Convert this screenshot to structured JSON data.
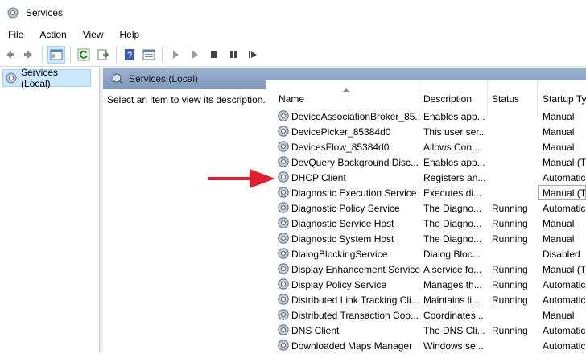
{
  "window": {
    "title": "Services"
  },
  "menu": [
    "File",
    "Action",
    "View",
    "Help"
  ],
  "tree": {
    "selected_label": "Services (Local)"
  },
  "pane": {
    "header_title": "Services (Local)",
    "description_text": "Select an item to view its description."
  },
  "table": {
    "columns": [
      "Name",
      "Description",
      "Status",
      "Startup Ty"
    ],
    "rows": [
      {
        "name": "DeviceAssociationBroker_85...",
        "description": "Enables app...",
        "status": "",
        "startup": "Manual"
      },
      {
        "name": "DevicePicker_85384d0",
        "description": "This user ser...",
        "status": "",
        "startup": "Manual"
      },
      {
        "name": "DevicesFlow_85384d0",
        "description": "Allows Con...",
        "status": "",
        "startup": "Manual"
      },
      {
        "name": "DevQuery Background Disc...",
        "description": "Enables app...",
        "status": "",
        "startup": "Manual (T"
      },
      {
        "name": "DHCP Client",
        "description": "Registers an...",
        "status": "",
        "startup": "Automatic"
      },
      {
        "name": "Diagnostic Execution Service",
        "description": "Executes di...",
        "status": "",
        "startup": "Manual (T"
      },
      {
        "name": "Diagnostic Policy Service",
        "description": "The Diagno...",
        "status": "Running",
        "startup": "Automatic"
      },
      {
        "name": "Diagnostic Service Host",
        "description": "The Diagno...",
        "status": "Running",
        "startup": "Manual"
      },
      {
        "name": "Diagnostic System Host",
        "description": "The Diagno...",
        "status": "Running",
        "startup": "Manual"
      },
      {
        "name": "DialogBlockingService",
        "description": "Dialog Bloc...",
        "status": "",
        "startup": "Disabled"
      },
      {
        "name": "Display Enhancement Service",
        "description": "A service fo...",
        "status": "Running",
        "startup": "Manual (T"
      },
      {
        "name": "Display Policy Service",
        "description": "Manages th...",
        "status": "Running",
        "startup": "Automatic"
      },
      {
        "name": "Distributed Link Tracking Cli...",
        "description": "Maintains li...",
        "status": "Running",
        "startup": "Automatic"
      },
      {
        "name": "Distributed Transaction Coo...",
        "description": "Coordinates...",
        "status": "",
        "startup": "Manual"
      },
      {
        "name": "DNS Client",
        "description": "The DNS Cli...",
        "status": "Running",
        "startup": "Automatic"
      },
      {
        "name": "Downloaded Maps Manager",
        "description": "Windows se...",
        "status": "",
        "startup": "Automatic"
      }
    ]
  },
  "colors": {
    "arrow": "#e0202a",
    "pane_header": "#8aa4c6",
    "selection": "#cce8ff"
  }
}
